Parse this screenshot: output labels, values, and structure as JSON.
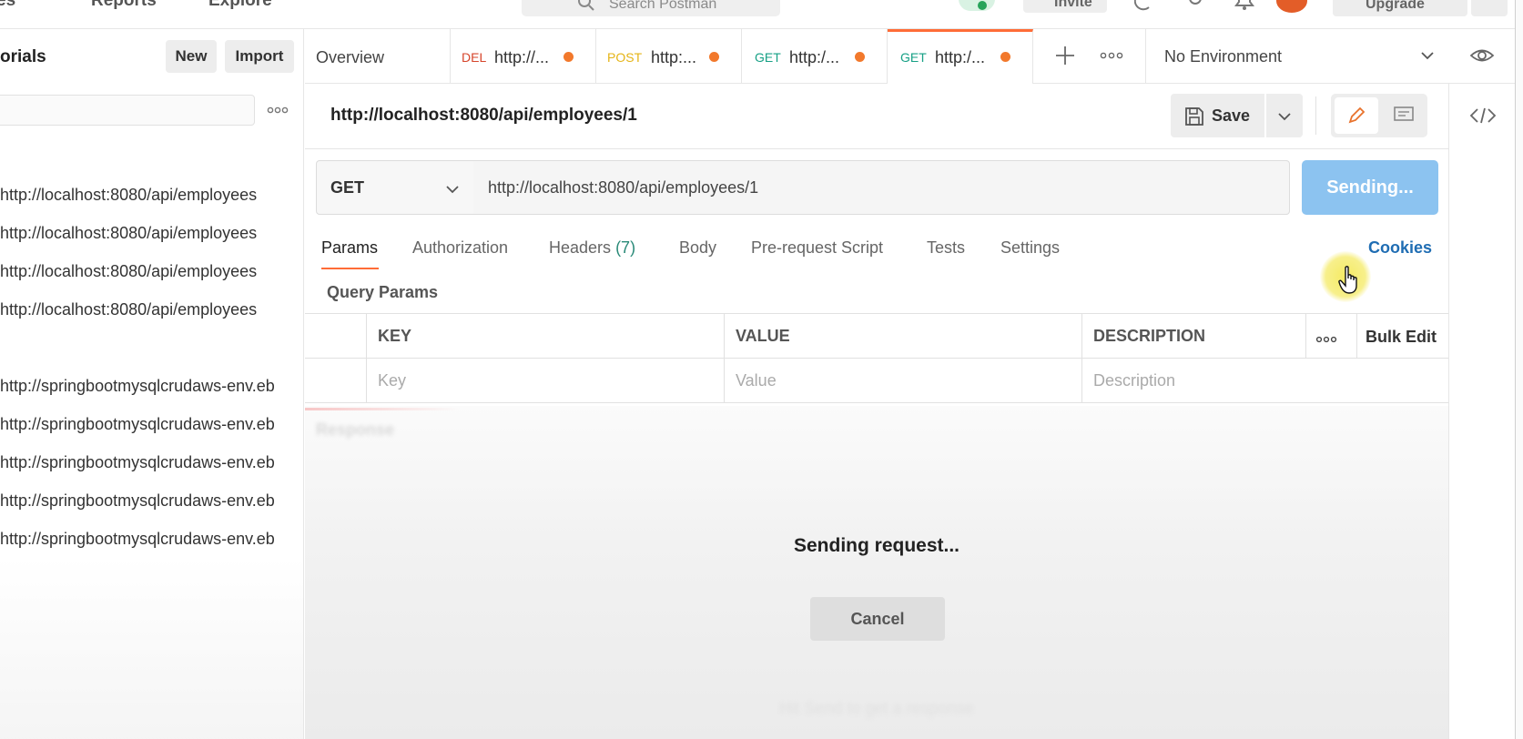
{
  "topbar": {
    "nav_left": "es",
    "nav_reports": "Reports",
    "nav_explore": "Explore",
    "search_placeholder": "Search Postman",
    "invite_label": "Invite",
    "upgrade_label": "Upgrade"
  },
  "sidebar": {
    "title": "orials",
    "new_label": "New",
    "import_label": "Import",
    "history": [
      "http://localhost:8080/api/employees",
      "http://localhost:8080/api/employees",
      "http://localhost:8080/api/employees",
      "http://localhost:8080/api/employees",
      "http://springbootmysqlcrudaws-env.eb",
      "http://springbootmysqlcrudaws-env.eb",
      "http://springbootmysqlcrudaws-env.eb",
      "http://springbootmysqlcrudaws-env.eb",
      "http://springbootmysqlcrudaws-env.eb"
    ]
  },
  "tabs": [
    {
      "label": "Overview"
    },
    {
      "method": "DEL",
      "url": "http://...",
      "method_color": "#d6452b"
    },
    {
      "method": "POST",
      "url": "http:...",
      "method_color": "#e5b416"
    },
    {
      "method": "GET",
      "url": "http:/...",
      "method_color": "#16a085"
    },
    {
      "method": "GET",
      "url": "http:/...",
      "method_color": "#16a085"
    }
  ],
  "environment": {
    "label": "No Environment"
  },
  "request": {
    "name": "http://localhost:8080/api/employees/1",
    "save_label": "Save",
    "method": "GET",
    "url": "http://localhost:8080/api/employees/1",
    "send_label": "Sending..."
  },
  "request_tabs": {
    "params": "Params",
    "authorization": "Authorization",
    "headers": "Headers",
    "headers_count": "(7)",
    "body": "Body",
    "prerequest": "Pre-request Script",
    "tests": "Tests",
    "settings": "Settings",
    "cookies": "Cookies"
  },
  "query_params": {
    "title": "Query Params",
    "columns": [
      "KEY",
      "VALUE",
      "DESCRIPTION"
    ],
    "placeholders": [
      "Key",
      "Value",
      "Description"
    ],
    "bulk_edit": "Bulk Edit"
  },
  "response": {
    "ghost_label": "Response",
    "sending_text": "Sending request...",
    "cancel_label": "Cancel",
    "ghost_hint": "Hit Send to get a response"
  },
  "colors": {
    "accent": "#ff6c37",
    "send_button": "#8cc3f0",
    "link": "#1f6db3",
    "modified_dot": "#f2792c"
  }
}
